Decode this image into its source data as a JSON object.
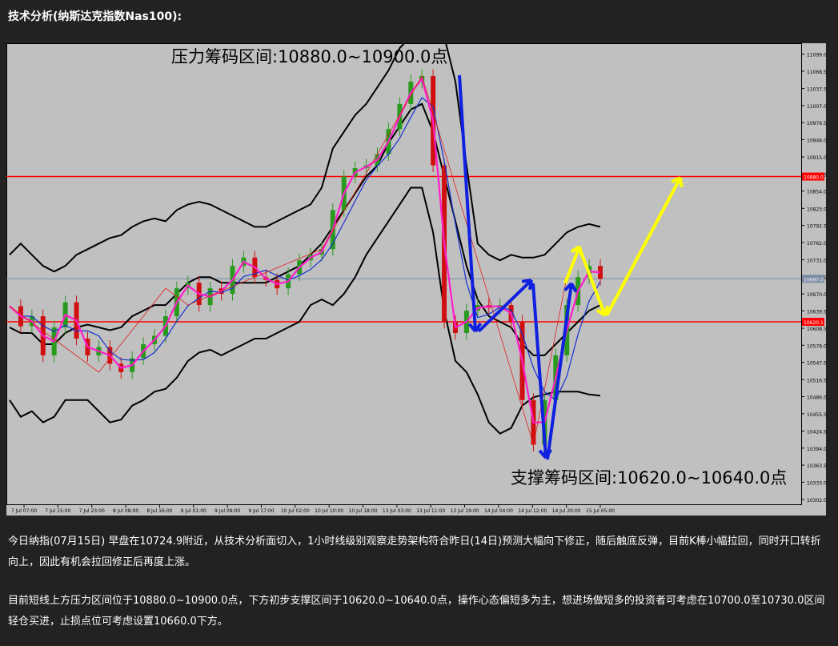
{
  "heading": "技术分析(纳斯达克指数Nas100):",
  "chart_data": {
    "type": "candlestick",
    "ylim": [
      10302.0,
      11110.0
    ],
    "y_ticks": [
      "11099.0",
      "11068.5",
      "11037.5",
      "11007.0",
      "10976.5",
      "10946.0",
      "10915.0",
      "10884.5",
      "10854.0",
      "10823.0",
      "10792.5",
      "10762.0",
      "10731.0",
      "10700.5",
      "10670.0",
      "10639.5",
      "10608.5",
      "10578.0",
      "10547.5",
      "10516.5",
      "10486.0",
      "10455.5",
      "10424.5",
      "10394.0",
      "10363.5",
      "10333.0",
      "10302.0"
    ],
    "x_ticks": [
      "7 Jul 07:00",
      "7 Jul 15:00",
      "7 Jul 23:00",
      "8 Jul 08:00",
      "8 Jul 16:00",
      "9 Jul 01:00",
      "9 Jul 09:00",
      "9 Jul 17:00",
      "10 Jul 02:00",
      "10 Jul 10:00",
      "10 Jul 18:00",
      "13 Jul 03:00",
      "13 Jul 11:00",
      "13 Jul 19:00",
      "14 Jul 04:00",
      "14 Jul 12:00",
      "14 Jul 20:00",
      "15 Jul 05:00"
    ],
    "current_price_label": "10697.0",
    "levels": [
      {
        "value": 10880.0,
        "label": "10880.0",
        "color": "#ff0000"
      },
      {
        "value": 10620.0,
        "label": "10620.1",
        "color": "#ff0000"
      },
      {
        "value": 10697.0,
        "label": "10697.0",
        "color": "#7b8ca4"
      }
    ],
    "series": [
      {
        "kind": "close",
        "values": [
          10648,
          10612,
          10630,
          10560,
          10610,
          10655,
          10590,
          10560,
          10575,
          10545,
          10530,
          10555,
          10580,
          10595,
          10630,
          10680,
          10690,
          10650,
          10680,
          10670,
          10720,
          10735,
          10700,
          10695,
          10680,
          10705,
          10730,
          10740,
          10750,
          10820,
          10880,
          10895,
          10900,
          10920,
          10965,
          11010,
          11050,
          11060,
          10900,
          10620,
          10600,
          10640,
          10650,
          10645,
          10650,
          10620,
          10480,
          10400,
          10480,
          10560,
          10650,
          10700,
          10720,
          10697
        ]
      },
      {
        "kind": "bollinger-upper",
        "values": [
          10740,
          10760,
          10740,
          10720,
          10710,
          10720,
          10740,
          10750,
          10760,
          10770,
          10775,
          10790,
          10800,
          10805,
          10800,
          10820,
          10830,
          10835,
          10830,
          10820,
          10810,
          10800,
          10790,
          10790,
          10800,
          10810,
          10820,
          10830,
          10860,
          10930,
          10960,
          10990,
          11010,
          11040,
          11070,
          11110,
          11130,
          11140,
          11150,
          11130,
          11050,
          10900,
          10760,
          10740,
          10730,
          10740,
          10735,
          10735,
          10740,
          10760,
          10780,
          10790,
          10795,
          10790
        ]
      },
      {
        "kind": "bollinger-middle",
        "values": [
          10610,
          10600,
          10600,
          10580,
          10580,
          10600,
          10610,
          10615,
          10610,
          10605,
          10610,
          10630,
          10640,
          10650,
          10650,
          10670,
          10690,
          10700,
          10700,
          10690,
          10690,
          10690,
          10690,
          10690,
          10700,
          10710,
          10720,
          10740,
          10760,
          10790,
          10820,
          10850,
          10880,
          10900,
          10940,
          10970,
          11000,
          11010,
          10960,
          10880,
          10800,
          10720,
          10660,
          10630,
          10620,
          10610,
          10580,
          10560,
          10560,
          10580,
          10600,
          10620,
          10640,
          10650
        ]
      },
      {
        "kind": "bollinger-lower",
        "values": [
          10480,
          10450,
          10460,
          10440,
          10450,
          10480,
          10480,
          10480,
          10460,
          10440,
          10445,
          10470,
          10480,
          10495,
          10500,
          10520,
          10550,
          10565,
          10570,
          10560,
          10570,
          10580,
          10590,
          10590,
          10600,
          10610,
          10620,
          10650,
          10660,
          10650,
          10670,
          10700,
          10740,
          10770,
          10800,
          10830,
          10860,
          10860,
          10780,
          10640,
          10550,
          10530,
          10490,
          10440,
          10420,
          10430,
          10470,
          10485,
          10490,
          10495,
          10495,
          10495,
          10490,
          10488
        ]
      }
    ],
    "annotations": [
      "压力筹码区间:10880.0~10900.0点",
      "支撑筹码区间:10620.0~10640.0点"
    ]
  },
  "paragraphs": [
    "今日纳指(07月15日) 早盘在10724.9附近，从技术分析面切入，1小时线级别观察走势架构符合昨日(14日)预测大幅向下修正，随后触底反弹，目前K棒小幅拉回，同时开口转折向上，因此有机会拉回修正后再度上涨。",
    "目前短线上方压力区间位于10880.0~10900.0点，下方初步支撑区间于10620.0~10640.0点，操作心态偏短多为主，想进场做短多的投资者可考虑在10700.0至10730.0区间轻仓买进，止损点位可考虑设置10660.0下方。"
  ]
}
